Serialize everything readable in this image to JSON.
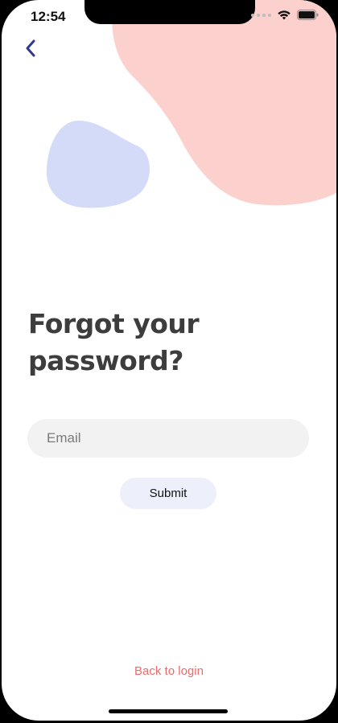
{
  "status_bar": {
    "time": "12:54"
  },
  "header": {
    "back_icon": "chevron-left-icon"
  },
  "main": {
    "title_line1": "Forgot your",
    "title_line2": "password?",
    "email_placeholder": "Email",
    "email_value": "",
    "submit_label": "Submit"
  },
  "footer": {
    "back_to_login": "Back to login"
  },
  "colors": {
    "pink_blob": "#fcd0cc",
    "blue_blob": "#d3dbf8",
    "accent_link": "#ee6a6a",
    "back_chevron": "#2f3a8f",
    "title_text": "#3d3d3d"
  }
}
